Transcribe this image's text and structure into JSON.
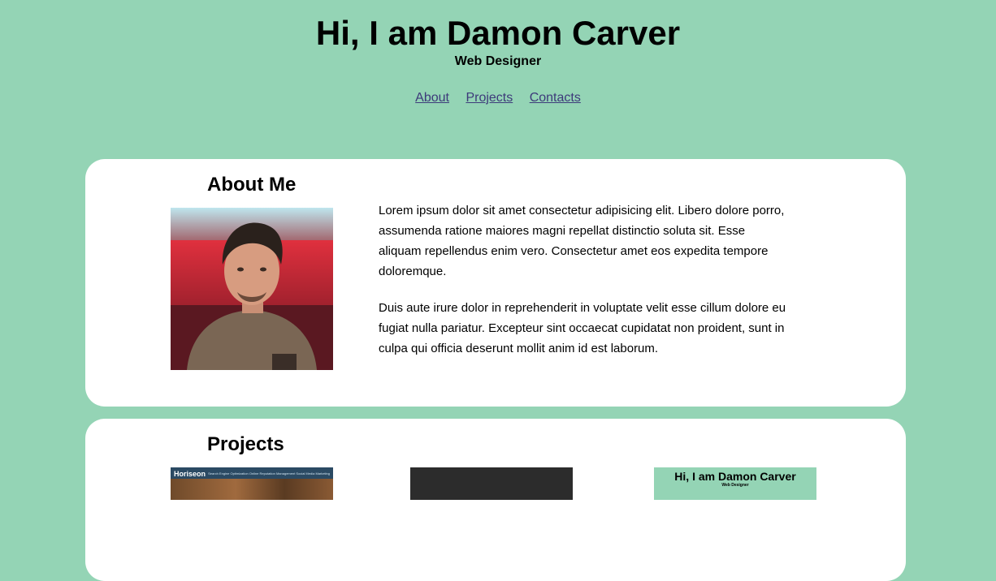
{
  "header": {
    "title": "Hi, I am Damon Carver",
    "subtitle": "Web Designer"
  },
  "nav": {
    "items": [
      {
        "label": "About"
      },
      {
        "label": "Projects"
      },
      {
        "label": "Contacts"
      }
    ]
  },
  "about": {
    "heading": "About Me",
    "paragraphs": [
      "Lorem ipsum dolor sit amet consectetur adipisicing elit. Libero dolore porro, assumenda ratione maiores magni repellat distinctio soluta sit. Esse aliquam repellendus enim vero. Consectetur amet eos expedita tempore doloremque.",
      "Duis aute irure dolor in reprehenderit in voluptate velit esse cillum dolore eu fugiat nulla pariatur. Excepteur sint occaecat cupidatat non proident, sunt in culpa qui officia deserunt mollit anim id est laborum."
    ]
  },
  "projects": {
    "heading": "Projects",
    "thumbnails": [
      {
        "brand": "Horiseon",
        "nav_text": "Search Engine Optimization   Online Reputation Management   Social Media Marketing"
      },
      {},
      {
        "title": "Hi, I am Damon Carver",
        "subtitle": "Web Designer"
      }
    ]
  },
  "colors": {
    "background": "#94d4b5",
    "card": "#ffffff",
    "link": "#3d3a7a"
  }
}
